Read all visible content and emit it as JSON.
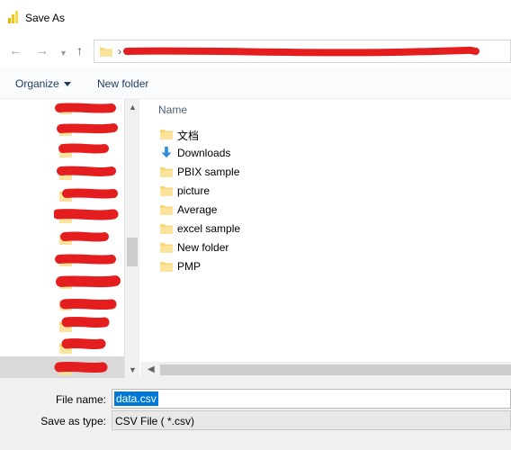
{
  "window": {
    "title": "Save As",
    "app_icon": "power-bi-icon",
    "accent": "#f2c811"
  },
  "nav": {
    "back_icon": "arrow-left-icon",
    "forward_icon": "arrow-right-icon",
    "recent_icon": "chevron-down-icon",
    "up_icon": "arrow-up-icon",
    "path_separator": "›"
  },
  "toolbar": {
    "organize_label": "Organize",
    "new_folder_label": "New folder"
  },
  "navigation_pane": {
    "item_count": 13
  },
  "content": {
    "column_header": "Name",
    "items": [
      {
        "label": "文档",
        "icon": "folder-icon"
      },
      {
        "label": "Downloads",
        "icon": "download-arrow-icon"
      },
      {
        "label": "PBIX sample",
        "icon": "folder-icon"
      },
      {
        "label": "picture",
        "icon": "folder-icon"
      },
      {
        "label": "Average",
        "icon": "folder-icon"
      },
      {
        "label": "excel sample",
        "icon": "folder-icon"
      },
      {
        "label": "New folder",
        "icon": "folder-icon"
      },
      {
        "label": "PMP",
        "icon": "folder-icon"
      }
    ]
  },
  "form": {
    "file_name_label": "File name:",
    "file_name_value": "data.csv",
    "save_type_label": "Save as type:",
    "save_type_value": "CSV File  ( *.csv)"
  },
  "colors": {
    "selection": "#0078d7",
    "folder": "#f8d775",
    "link": "#1e3a5f"
  }
}
